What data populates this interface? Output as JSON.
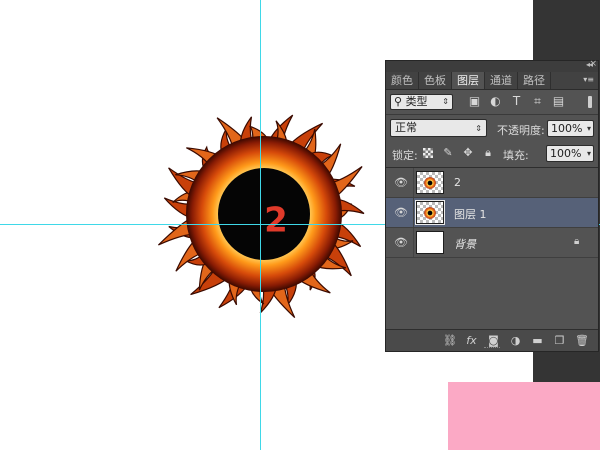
{
  "canvas": {
    "badge_number": "2",
    "colors": {
      "background": "#ffffff",
      "guide": "#3fd8e8",
      "badge_text": "#e03a2a",
      "side_dark": "#343434",
      "pink_block": "#fba9c5"
    }
  },
  "panel": {
    "tabs": [
      {
        "label": "颜色",
        "active": false
      },
      {
        "label": "色板",
        "active": false
      },
      {
        "label": "图层",
        "active": true
      },
      {
        "label": "通道",
        "active": false
      },
      {
        "label": "路径",
        "active": false
      }
    ],
    "filter": {
      "kind_label": "类型",
      "icons": [
        "image-filter-icon",
        "adjustment-filter-icon",
        "type-filter-icon",
        "shape-filter-icon",
        "smart-object-filter-icon"
      ]
    },
    "blend_mode": "正常",
    "opacity_label": "不透明度:",
    "opacity_value": "100%",
    "lock_label": "锁定:",
    "lock_icons": [
      "lock-transparent-icon",
      "lock-image-icon",
      "lock-position-icon",
      "lock-all-icon"
    ],
    "fill_label": "填充:",
    "fill_value": "100%",
    "layers": [
      {
        "name": "2",
        "selected": false,
        "visible": true,
        "thumbnail": "sun"
      },
      {
        "name": "图层 1",
        "selected": true,
        "visible": true,
        "thumbnail": "sun"
      },
      {
        "name": "背景",
        "selected": false,
        "visible": true,
        "thumbnail": "white",
        "locked": true
      }
    ],
    "bottom_icons": [
      "link-icon",
      "fx-icon",
      "mask-icon",
      "adjustment-icon",
      "folder-icon",
      "new-layer-icon",
      "trash-icon"
    ],
    "colors": {
      "panel_bg": "#535353",
      "selected_row": "#566178"
    }
  }
}
